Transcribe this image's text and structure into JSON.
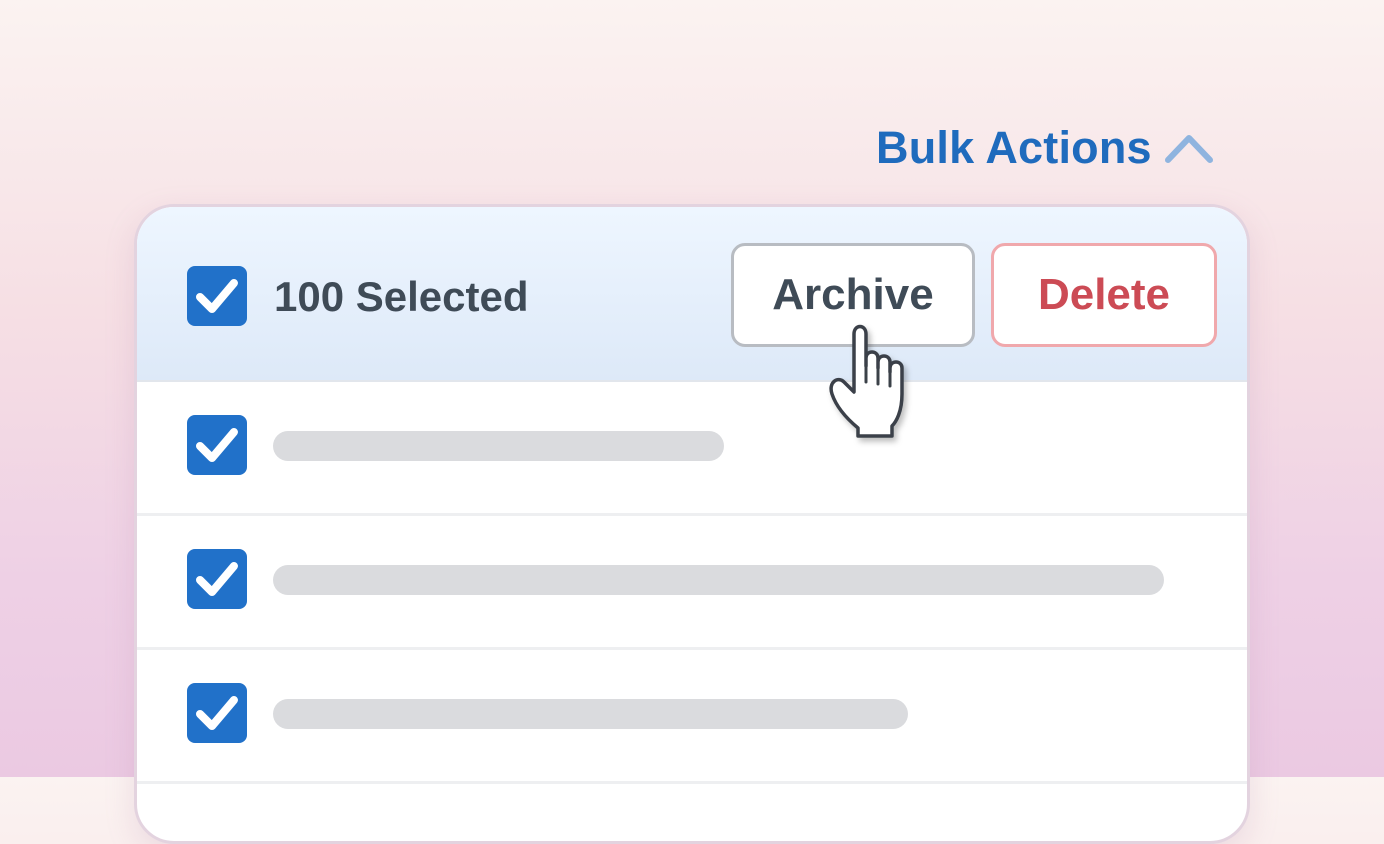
{
  "bulk_actions": {
    "label": "Bulk Actions",
    "icon": "chevron-up-icon",
    "color": "#1f6bbd"
  },
  "header": {
    "select_all_checked": true,
    "selected_label": "100 Selected",
    "archive_label": "Archive",
    "delete_label": "Delete"
  },
  "rows": [
    {
      "checked": true,
      "placeholder_fill": 0.44
    },
    {
      "checked": true,
      "placeholder_fill": 0.87
    },
    {
      "checked": true,
      "placeholder_fill": 0.62
    }
  ],
  "colors": {
    "accent": "#2171c9",
    "danger": "#cc4b55",
    "text": "#3f4b57"
  },
  "cursor": {
    "icon": "hand-pointer-icon"
  }
}
